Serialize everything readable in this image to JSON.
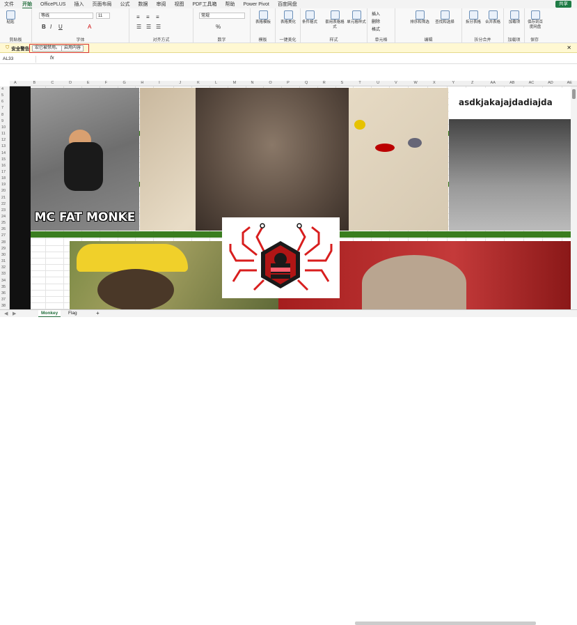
{
  "menu": {
    "tabs": [
      "文件",
      "开始",
      "OfficePLUS",
      "插入",
      "页面布局",
      "公式",
      "数据",
      "审阅",
      "视图",
      "PDF工具箱",
      "帮助",
      "Power Pivot",
      "百度网盘"
    ],
    "active": "开始",
    "share": "共享"
  },
  "ribbon": {
    "paste": "粘贴",
    "clipboard": "剪贴板",
    "font_name": "等线",
    "font_size": "11",
    "font_group": "字体",
    "align_group": "对齐方式",
    "num_format": "常规",
    "num_group": "数字",
    "template_btn": "表格模板",
    "template_group": "模板",
    "beautify_btn": "表格美化",
    "beautify_group": "一键美化",
    "cond_btn": "条件格式",
    "table_btn": "套用表格格式",
    "cell_style_btn": "单元格样式",
    "style_group": "样式",
    "insert_btn": "插入",
    "delete_btn": "删除",
    "format_btn": "格式",
    "cell_group": "单元格",
    "sort_btn": "排序和筛选",
    "find_btn": "查找和选择",
    "edit_group": "编辑",
    "split_btn": "拆分表格",
    "merge_btn": "合并表格",
    "split_group": "拆分合并",
    "addin_btn": "加载项",
    "addin_group": "加载项",
    "save_baidu_btn": "保存到百度网盘",
    "save_group": "保存"
  },
  "security": {
    "label": "安全警告",
    "macro_btn": "宏已被禁用。",
    "enable_btn": "启用内容"
  },
  "formula_bar": {
    "name_box": "AL33",
    "fx": "fx"
  },
  "columns": [
    "A",
    "B",
    "C",
    "D",
    "E",
    "F",
    "G",
    "H",
    "I",
    "J",
    "K",
    "L",
    "M",
    "N",
    "O",
    "P",
    "Q",
    "R",
    "S",
    "T",
    "U",
    "V",
    "W",
    "X",
    "Y",
    "Z",
    "AA",
    "AB",
    "AC",
    "AD",
    "AE"
  ],
  "rows": [
    "4",
    "5",
    "6",
    "7",
    "8",
    "9",
    "10",
    "11",
    "12",
    "13",
    "14",
    "15",
    "16",
    "17",
    "18",
    "19",
    "20",
    "21",
    "22",
    "23",
    "24",
    "25",
    "26",
    "27",
    "28",
    "29",
    "30",
    "31",
    "32",
    "33",
    "34",
    "35",
    "36",
    "37",
    "38"
  ],
  "images": {
    "caption_monke": "MC FAT MONKE",
    "caption_text": "asdkjakajajdadiajda"
  },
  "sheets": {
    "tabs": [
      "Monkey",
      "Flag"
    ],
    "active": "Monkey",
    "add": "+"
  }
}
